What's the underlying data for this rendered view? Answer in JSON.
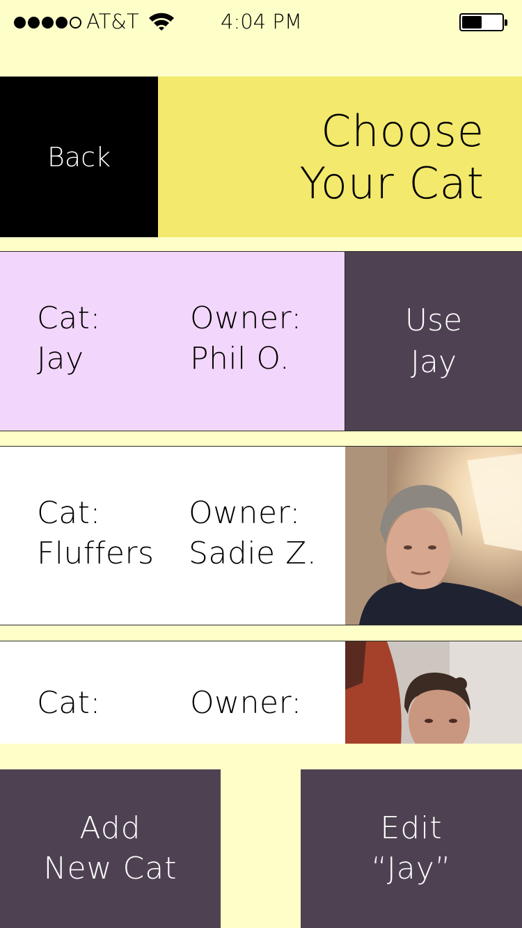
{
  "status_bar": {
    "carrier": "AT&T",
    "time": "4:04 PM",
    "signal_bars_filled": 4,
    "signal_bars_total": 5,
    "battery_level": 0.5
  },
  "header": {
    "back_label": "Back",
    "title_line1": "Choose",
    "title_line2": "Your Cat"
  },
  "cats": [
    {
      "cat_label": "Cat:",
      "cat_name": "Jay",
      "owner_label": "Owner:",
      "owner_name": "Phil O.",
      "action_line1": "Use",
      "action_line2": "Jay"
    },
    {
      "cat_label": "Cat:",
      "cat_name": "Fluffers",
      "owner_label": "Owner:",
      "owner_name": "Sadie Z.",
      "photo": "owner-photo"
    },
    {
      "cat_label": "Cat:",
      "cat_name": "",
      "owner_label": "Owner:",
      "owner_name": "",
      "photo": "owner-photo"
    }
  ],
  "footer": {
    "add_line1": "Add",
    "add_line2": "New Cat",
    "edit_line1": "Edit",
    "edit_line2": "“Jay”"
  },
  "colors": {
    "background": "#fefec8",
    "header_accent": "#f3e96c",
    "selected_row": "#f3d6fb",
    "button_dark": "#4e4252",
    "back_button": "#000000"
  }
}
